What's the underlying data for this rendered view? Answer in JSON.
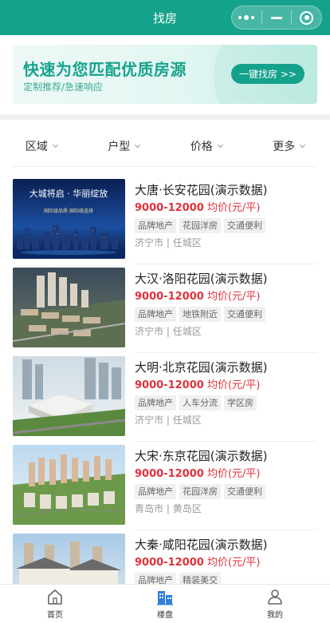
{
  "header": {
    "title": "找房"
  },
  "banner": {
    "title": "快速为您匹配优质房源",
    "subtitle": "定制推荐/急速响应",
    "button": "一键找房 >>"
  },
  "filters": [
    "区域",
    "户型",
    "价格",
    "更多"
  ],
  "listings": [
    {
      "name": "大唐·长安花园(演示数据)",
      "price_range": "9000-12000",
      "price_unit": " 均价(元/平)",
      "tags": [
        "品牌地产",
        "花园洋房",
        "交通便利"
      ],
      "city": "济宁市",
      "district": "任城区",
      "image_caption": {
        "line1": "大城将启 · 华丽绽放",
        "line2": "国际级品质  国际级选择"
      }
    },
    {
      "name": "大汉·洛阳花园(演示数据)",
      "price_range": "9000-12000",
      "price_unit": " 均价(元/平)",
      "tags": [
        "品牌地产",
        "地铁附近",
        "交通便利"
      ],
      "city": "济宁市",
      "district": "任城区"
    },
    {
      "name": "大明·北京花园(演示数据)",
      "price_range": "9000-12000",
      "price_unit": " 均价(元/平)",
      "tags": [
        "品牌地产",
        "人车分流",
        "学区房"
      ],
      "city": "济宁市",
      "district": "任城区"
    },
    {
      "name": "大宋·东京花园(演示数据)",
      "price_range": "9000-12000",
      "price_unit": " 均价(元/平)",
      "tags": [
        "品牌地产",
        "花园洋房",
        "交通便利"
      ],
      "city": "青岛市",
      "district": "黄岛区"
    },
    {
      "name": "大秦·咸阳花园(演示数据)",
      "price_range": "9000-12000",
      "price_unit": " 均价(元/平)",
      "tags": [
        "品牌地产",
        "精装美交"
      ],
      "city": "",
      "district": ""
    }
  ],
  "tabbar": [
    {
      "label": "首页",
      "icon": "home-icon"
    },
    {
      "label": "楼盘",
      "icon": "building-icon",
      "active": true
    },
    {
      "label": "我的",
      "icon": "user-icon"
    }
  ],
  "colors": {
    "brand": "#15a28b",
    "price": "#e0323b",
    "active_icon": "#2f7fd8"
  }
}
